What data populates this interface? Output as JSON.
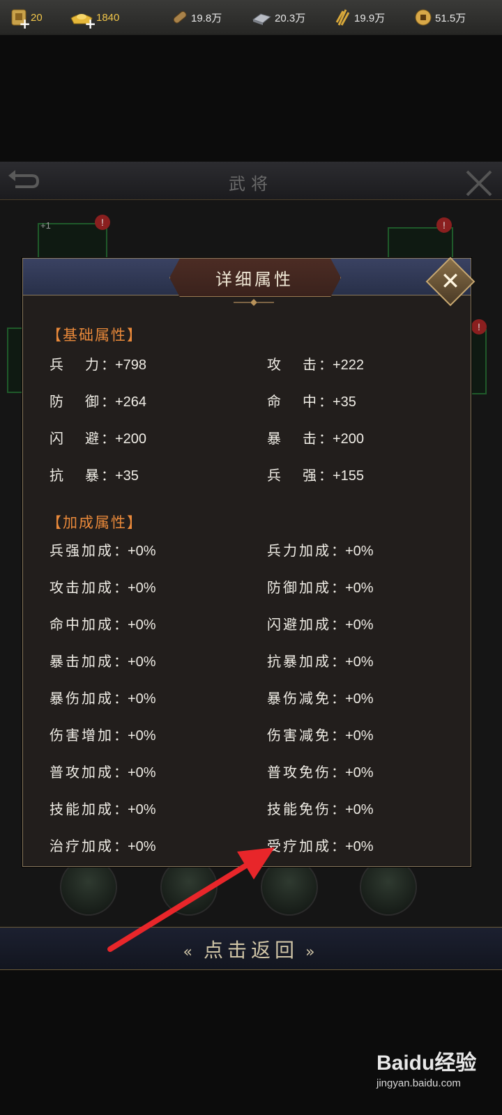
{
  "topbar": {
    "resources": [
      {
        "icon": "seal-icon",
        "value": "20",
        "has_plus": true
      },
      {
        "icon": "gold-ingot-icon",
        "value": "1840",
        "has_plus": true
      },
      {
        "icon": "wood-icon",
        "value": "19.8万"
      },
      {
        "icon": "iron-icon",
        "value": "20.3万"
      },
      {
        "icon": "grain-icon",
        "value": "19.9万"
      },
      {
        "icon": "coin-icon",
        "value": "51.5万"
      }
    ]
  },
  "background": {
    "title": "武将",
    "card_badge": "+1",
    "alert": "!"
  },
  "dialog": {
    "title": "详细属性",
    "close_glyph": "✕",
    "basic_section": "【基础属性】",
    "basic": [
      {
        "label": "兵力",
        "value": "：+798"
      },
      {
        "label": "攻击",
        "value": "：+222"
      },
      {
        "label": "防御",
        "value": "：+264"
      },
      {
        "label": "命中",
        "value": "：+35"
      },
      {
        "label": "闪避",
        "value": "：+200"
      },
      {
        "label": "暴击",
        "value": "：+200"
      },
      {
        "label": "抗暴",
        "value": "：+35"
      },
      {
        "label": "兵强",
        "value": "：+155"
      }
    ],
    "bonus_section": "【加成属性】",
    "bonus": [
      {
        "label": "兵强加成",
        "value": "：+0%"
      },
      {
        "label": "兵力加成",
        "value": "：+0%"
      },
      {
        "label": "攻击加成",
        "value": "：+0%"
      },
      {
        "label": "防御加成",
        "value": "：+0%"
      },
      {
        "label": "命中加成",
        "value": "：+0%"
      },
      {
        "label": "闪避加成",
        "value": "：+0%"
      },
      {
        "label": "暴击加成",
        "value": "：+0%"
      },
      {
        "label": "抗暴加成",
        "value": "：+0%"
      },
      {
        "label": "暴伤加成",
        "value": "：+0%"
      },
      {
        "label": "暴伤减免",
        "value": "：+0%"
      },
      {
        "label": "伤害增加",
        "value": "：+0%"
      },
      {
        "label": "伤害减免",
        "value": "：+0%"
      },
      {
        "label": "普攻加成",
        "value": "：+0%"
      },
      {
        "label": "普攻免伤",
        "value": "：+0%"
      },
      {
        "label": "技能加成",
        "value": "：+0%"
      },
      {
        "label": "技能免伤",
        "value": "：+0%"
      },
      {
        "label": "治疗加成",
        "value": "：+0%"
      },
      {
        "label": "受疗加成",
        "value": "：+0%"
      }
    ]
  },
  "return_button": {
    "label": "点击返回",
    "left_chevron": "«",
    "right_chevron": "»"
  },
  "watermark": {
    "top": "Baidu经验",
    "bottom": "jingyan.baidu.com"
  },
  "colors": {
    "section": "#e9893a",
    "arrow": "#e8262a",
    "gold_text": "#f2c64a"
  }
}
